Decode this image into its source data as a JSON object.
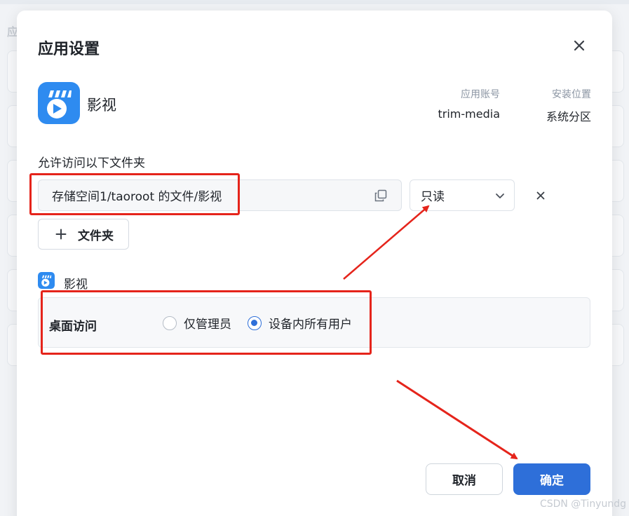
{
  "background": {
    "page_heading_fragment": "应"
  },
  "dialog": {
    "title": "应用设置",
    "app": {
      "name": "影视",
      "icon": "film-app-icon",
      "brand_color": "#2e8bf0"
    },
    "meta": {
      "account_label": "应用账号",
      "account_value": "trim-media",
      "location_label": "安装位置",
      "location_value": "系统分区"
    },
    "folders": {
      "label": "允许访问以下文件夹",
      "path": "存储空间1/taoroot 的文件/影视",
      "permission": "只读",
      "add_button": "文件夹"
    },
    "desktop_access": {
      "section_label": "影视",
      "label": "桌面访问",
      "options": [
        {
          "label": "仅管理员",
          "checked": false
        },
        {
          "label": "设备内所有用户",
          "checked": true
        }
      ]
    },
    "buttons": {
      "cancel": "取消",
      "ok": "确定"
    }
  },
  "colors": {
    "accent": "#2e6fd9",
    "annotation": "#e5241b"
  },
  "watermark": "CSDN @Tinyundg"
}
